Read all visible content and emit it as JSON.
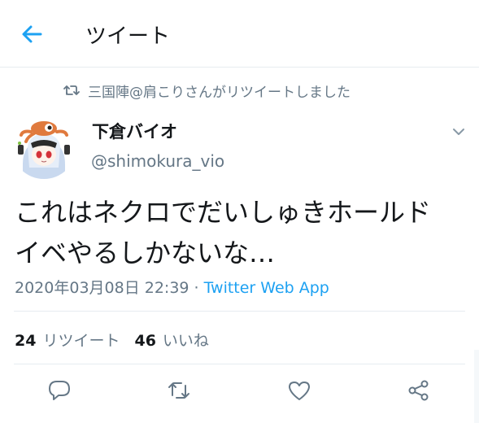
{
  "header": {
    "title": "ツイート"
  },
  "retweet_notice": {
    "text": "三国陣@肩こりさんがリツイートしました"
  },
  "author": {
    "name": "下倉バイオ",
    "handle": "@shimokura_vio"
  },
  "tweet": {
    "line1": "これはネクロでだいしゅきホールド",
    "line2": "イベやるしかないな…",
    "timestamp": "2020年03月08日 22:39",
    "separator": "·",
    "source": "Twitter Web App"
  },
  "stats": {
    "retweets_count": "24",
    "retweets_label": "リツイート",
    "likes_count": "46",
    "likes_label": "いいね"
  },
  "colors": {
    "accent": "#1da1f2",
    "secondary_text": "#657786",
    "divider": "#e6ecf0"
  },
  "icons": [
    "back-arrow-icon",
    "retweet-icon",
    "chevron-down-icon",
    "reply-icon",
    "retweet-icon",
    "like-icon",
    "share-icon"
  ]
}
